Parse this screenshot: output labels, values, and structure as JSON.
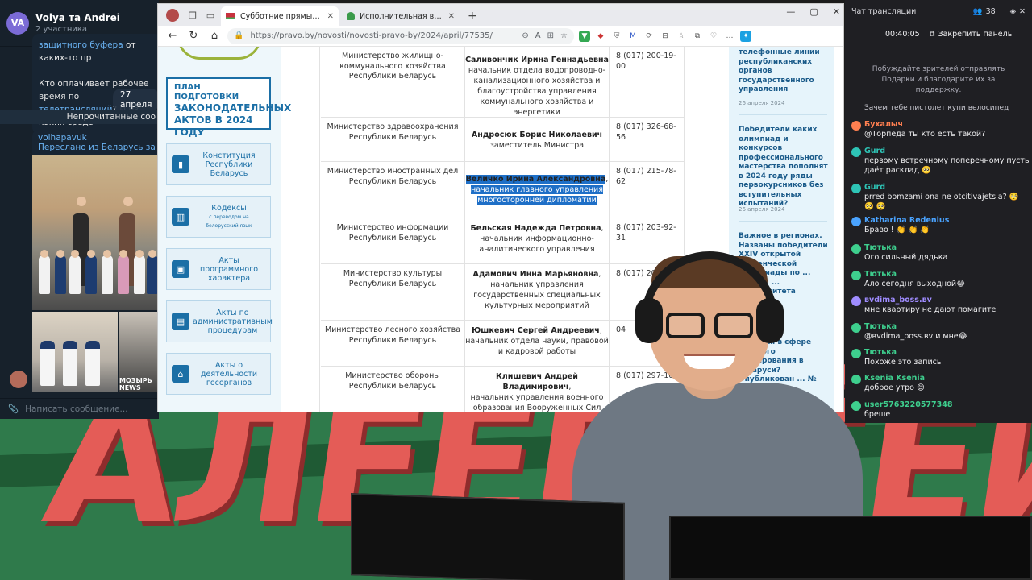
{
  "telegram": {
    "avatar_initials": "VA",
    "chat_title": "Volya та Andrei",
    "chat_subtitle": "2 участника",
    "msg1_line1_link": "защитного буфера",
    "msg1_line1_rest": " от каких-то пр",
    "msg1_line2": "Кто оплачивает рабочее время по",
    "msg1_line3_link": "телетрансляций",
    "msg1_line3_rest": "? И из каких средс",
    "date_badge": "27 апреля",
    "unread_label": "Непрочитанные соо",
    "forward_author": "volhapavuk",
    "forward_from": "Переслано из Беларусь за МКАД",
    "photo_caption": "МОЗЫРЬ NEWS",
    "input_placeholder": "Написать сообщение..."
  },
  "browser": {
    "tabs": [
      {
        "label": "Субботние прямые телефонны",
        "active": true
      },
      {
        "label": "Исполнительная власть | | Лиса",
        "active": false
      }
    ],
    "url": "https://pravo.by/novosti/novosti-pravo-by/2024/april/77535/",
    "win_controls": [
      "—",
      "▢",
      "✕"
    ]
  },
  "sidebar": {
    "plan_line1": "ПЛАН ПОДГОТОВКИ",
    "plan_line2": "ЗАКОНОДАТЕЛЬНЫХ",
    "plan_line3": "АКТОВ В 2024 ГОДУ",
    "nav": [
      {
        "label": "Конституция Республики Беларусь",
        "sub": ""
      },
      {
        "label": "Кодексы",
        "sub": "с переводом на белорусский язык"
      },
      {
        "label": "Акты программного характера",
        "sub": ""
      },
      {
        "label": "Акты по административным процедурам",
        "sub": ""
      },
      {
        "label": "Акты о деятельности госорганов",
        "sub": ""
      }
    ]
  },
  "table": {
    "rows": [
      {
        "org": "Министерство жилищно-коммунального хозяйства Республики Беларусь",
        "name": "Саливончик Ирина Геннадьевна",
        "position": "начальник отдела водопроводно-канализационного хозяйства и благоустройства управления коммунального хозяйства и энергетики",
        "phone": "8 (017) 200-19-00"
      },
      {
        "org": "Министерство здравоохранения Республики Беларусь",
        "name": "Андросюк Борис Николаевич",
        "position": "заместитель Министра",
        "phone": "8 (017) 326-68-56"
      },
      {
        "org": "Министерство иностранных дел Республики Беларусь",
        "name": "Величко Ирина Александровна",
        "position": "начальник главного управления многосторонней дипломатии",
        "phone": "8 (017) 215-78-62"
      },
      {
        "org": "Министерство информации Республики Беларусь",
        "name": "Бельская Надежда Петровна",
        "position": "начальник информационно-аналитического управления",
        "phone": "8 (017) 203-92-31"
      },
      {
        "org": "Министерство культуры Республики Беларусь",
        "name": "Адамович Инна Марьяновна",
        "position": "начальник управления государственных специальных культурных мероприятий",
        "phone": "8 (017) 203-7"
      },
      {
        "org": "Министерство лесного хозяйства Республики Беларусь",
        "name": "Юшкевич Сергей Андреевич",
        "position": "начальник отдела науки, правовой и кадровой работы",
        "phone": "04"
      },
      {
        "org": "Министерство обороны Республики Беларусь",
        "name": "Клишевич Андрей Владимирович",
        "position": "начальник управления военного образования Вооруженных Сил",
        "phone": "8 (017) 297-10"
      }
    ]
  },
  "news": [
    {
      "title": "телефонные линии республиканских органов государственного управления",
      "date": "26 апреля 2024"
    },
    {
      "title": "Победители каких олимпиад и конкурсов профессионального мастерства пополнят в 2024 году ряды первокурсников без вступительных испытаний?",
      "date": "26 апреля 2024"
    },
    {
      "title": "Важное в регионах. Названы победители XXIV открытой студенческой олимпиады по ... наукам ... университета",
      "date": "2024"
    },
    {
      "title": "...енится в сфере ...енного ...улирования в ...ларуси? Опубликован ... № 366-З",
      "date": ""
    }
  ],
  "banner": {
    "text": "АЛЁЁЁЁЁЁЙ"
  },
  "chat": {
    "title": "Чат трансляции",
    "viewers": "38",
    "timer": "00:40:05",
    "pin_label": "Закрепить панель",
    "promo": "Побуждайте зрителей отправлять Подарки и благодарите их за поддержку.",
    "first_line": "Зачем тебе пистолет купи велосипед",
    "messages": [
      {
        "name": "Бухалыч",
        "text": "@Торпеда ты кто есть такой?",
        "color": "#ff7f50"
      },
      {
        "name": "Gurd",
        "text": "первому встречному поперечному пусть даёт расклад 🥺",
        "color": "#2ec4b6"
      },
      {
        "name": "Gurd",
        "text": "prred bomzami ona ne otcitivajetsia? 🥺 🥺 🥺",
        "color": "#2ec4b6"
      },
      {
        "name": "Katharina Redenius",
        "text": "Браво ! 👏 👏 👏",
        "color": "#4aa3ff"
      },
      {
        "name": "Тютька",
        "text": "Ого сильный дядька",
        "color": "#3ecf8e"
      },
      {
        "name": "Тютька",
        "text": "Ало сегодня выходной😂",
        "color": "#3ecf8e"
      },
      {
        "name": "вvdima_boss.вv",
        "text": "мне квартиру не дают помагите",
        "color": "#9f8cff"
      },
      {
        "name": "Тютька",
        "text": "@вvdima_boss.вv и мне😂",
        "color": "#3ecf8e"
      },
      {
        "name": "Тютька",
        "text": "Похоже это запись",
        "color": "#3ecf8e"
      },
      {
        "name": "Ksenia Ksenia",
        "text": "доброе утро 😊",
        "color": "#3ecf8e"
      },
      {
        "name": "user5763220577348",
        "text": "бреше",
        "color": "#3ecf8e"
      }
    ]
  },
  "colors": {
    "accent": "#1b6fa6",
    "highlight": "#1e6fc7",
    "banner": "#e45c57"
  }
}
